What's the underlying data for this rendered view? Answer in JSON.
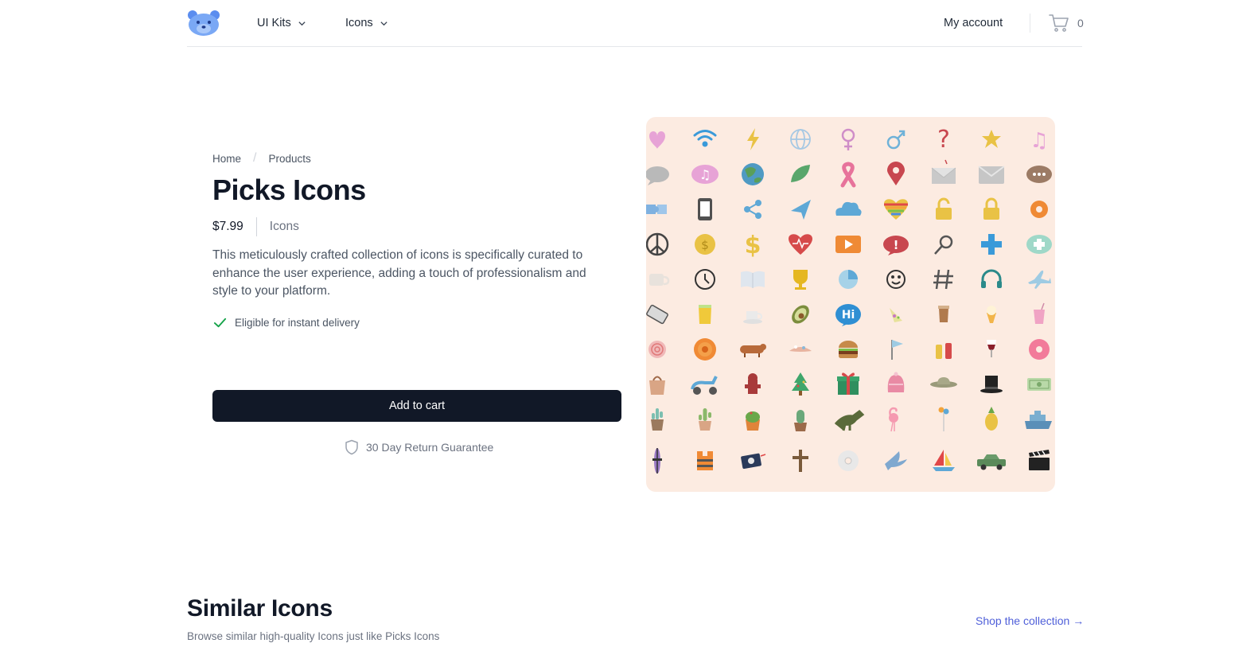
{
  "header": {
    "logo_icon": "bear-face-logo",
    "nav": [
      {
        "label": "UI Kits",
        "icon": "chevron-down-icon"
      },
      {
        "label": "Icons",
        "icon": "chevron-down-icon"
      }
    ],
    "account_label": "My account",
    "cart_icon": "shopping-cart-icon",
    "cart_count": "0"
  },
  "breadcrumb": {
    "items": [
      "Home",
      "Products"
    ],
    "separator": "/"
  },
  "product": {
    "title": "Picks Icons",
    "price": "$7.99",
    "category": "Icons",
    "description": "This meticulously crafted collection of icons is specifically curated to enhance the user experience, adding a touch of professionalism and style to your platform.",
    "delivery_label": "Eligible for instant delivery",
    "add_to_cart_label": "Add to cart",
    "guarantee_label": "30 Day Return Guarantee",
    "preview_background": "#fcebe1"
  },
  "similar": {
    "title": "Similar Icons",
    "subtitle": "Browse similar high-quality Icons just like Picks Icons",
    "link_label": "Shop the collection →"
  },
  "colors": {
    "primary_button": "#111827",
    "check_green": "#16a34a",
    "link": "#4f5fd9"
  }
}
